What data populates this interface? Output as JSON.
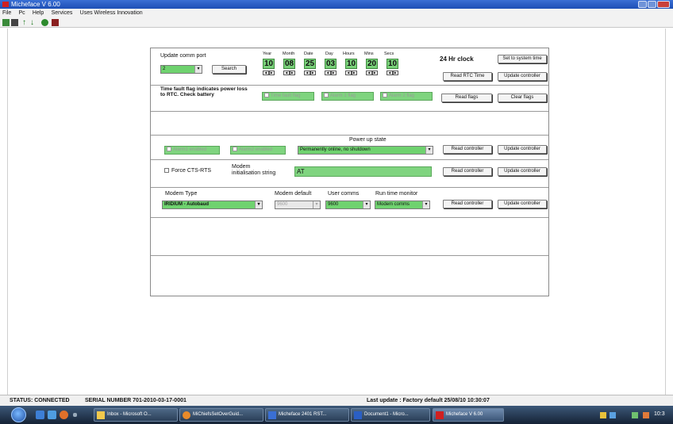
{
  "window": {
    "title": "Micheface V 6.00"
  },
  "menu": [
    "File",
    "Pc",
    "Help",
    "Services",
    "Uses Wireless Innovation"
  ],
  "toolbar_icons": [
    "chip-icon",
    "save-icon",
    "upload-icon",
    "download-icon",
    "help-icon",
    "exit-icon"
  ],
  "comms": {
    "label": "Update comm port",
    "port_value": "2",
    "search_label": "Search"
  },
  "clock": {
    "fields": [
      {
        "label": "Year",
        "value": "10"
      },
      {
        "label": "Month",
        "value": "08"
      },
      {
        "label": "Date",
        "value": "25"
      },
      {
        "label": "Day",
        "value": "03"
      },
      {
        "label": "Hours",
        "value": "10"
      },
      {
        "label": "Mins",
        "value": "20"
      },
      {
        "label": "Secs",
        "value": "10"
      }
    ],
    "mode_label": "24 Hr clock",
    "set_system_time": "Set to system time",
    "read_rtc_time": "Read RTC Time",
    "update_controller": "Update controller"
  },
  "flags": {
    "description": "Time fault flag indicates power loss to RTC. Check battery",
    "items": [
      "Time fault flag",
      "Alarm 1 flag",
      "Alarm 2 flag"
    ],
    "read_flags": "Read flags",
    "clear_flags": "Clear flags"
  },
  "power": {
    "alarm1": "Alarm1 enabled",
    "alarm2": "Alarm2 enabled",
    "state_label": "Power up state",
    "state_value": "Permanently online, no shutdown",
    "read_controller": "Read controller",
    "update_controller": "Update controller"
  },
  "modem_init": {
    "force_cts": "Force CTS-RTS",
    "label": "Modem initialisation string",
    "value": "AT",
    "read_controller": "Read controller",
    "update_controller": "Update controller"
  },
  "modem_type": {
    "type_label": "Modem Type",
    "type_value": "IRIDIUM - Autobaud",
    "default_label": "Modem default",
    "default_value": "9600",
    "user_label": "User comms",
    "user_value": "9600",
    "runtime_label": "Run time monitor",
    "runtime_value": "Modem comms",
    "read_controller": "Read controller",
    "update_controller": "Update controller"
  },
  "status": {
    "connection": "STATUS: CONNECTED",
    "serial": "SERIAL NUMBER 701-2010-03-17-0001",
    "last_update": "Last update : Factory default 25/08/10 10:30:07"
  },
  "taskbar": {
    "items": [
      "Inbox - Microsoft O...",
      "MiChiefsSetOverGuid...",
      "Micheface 2401 RST...",
      "Document1 - Micro...",
      "Micheface V 6.00"
    ],
    "clock": "10:3"
  },
  "colors": {
    "accent_green": "#7fd47f",
    "title_blue": "#1d4fb5"
  }
}
